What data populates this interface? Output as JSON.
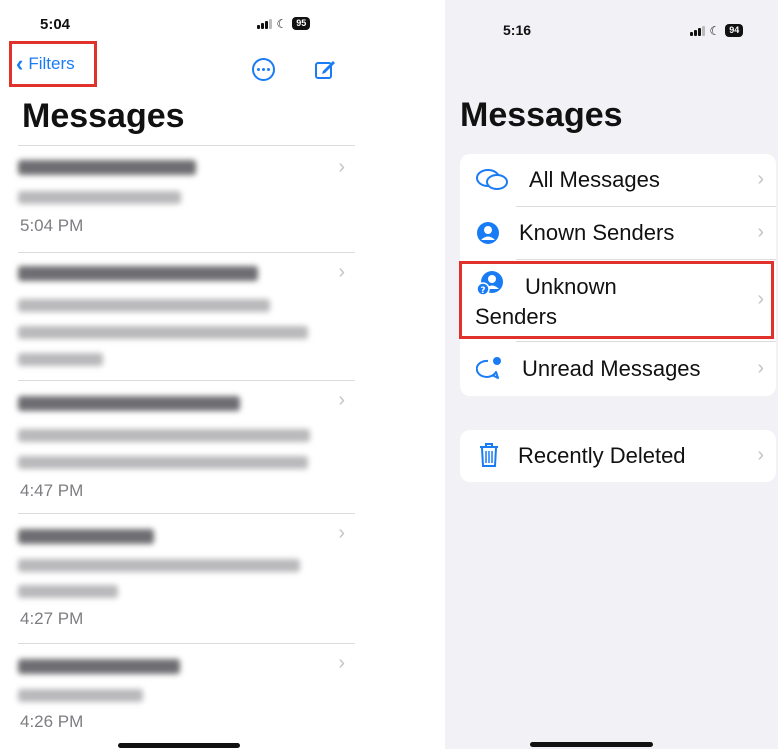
{
  "left_screen": {
    "status": {
      "time": "5:04",
      "battery": "95"
    },
    "nav": {
      "back_label": "Filters"
    },
    "title": "Messages",
    "messages": [
      {
        "time": "5:04 PM"
      },
      {
        "time": ""
      },
      {
        "time": "4:47 PM"
      },
      {
        "time": "4:27 PM"
      },
      {
        "time": "4:26 PM"
      }
    ]
  },
  "right_screen": {
    "status": {
      "time": "5:16",
      "battery": "94"
    },
    "title": "Messages",
    "filters": [
      {
        "label": "All Messages",
        "icon": "chat-bubbles-icon"
      },
      {
        "label": "Known Senders",
        "icon": "person-circle-icon"
      },
      {
        "label": "Unknown Senders",
        "icon": "unknown-person-icon"
      },
      {
        "label": "Unread Messages",
        "icon": "unread-bubble-icon"
      }
    ],
    "recently_deleted": {
      "label": "Recently Deleted",
      "icon": "trash-icon"
    }
  },
  "colors": {
    "accent": "#1a7cf5",
    "highlight": "#e0312a",
    "chevron": "#c4c4c8"
  }
}
